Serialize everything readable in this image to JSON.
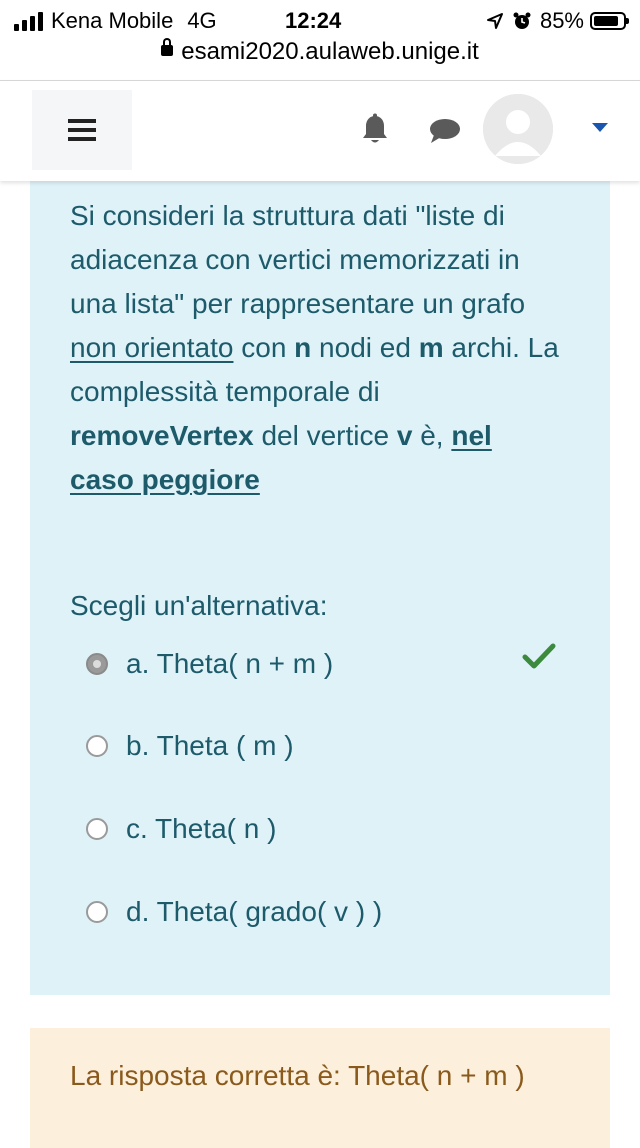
{
  "status_bar": {
    "carrier": "Kena Mobile",
    "network": "4G",
    "time": "12:24",
    "battery_percent": "85%",
    "battery_level": 0.85
  },
  "browser": {
    "url": "esami2020.aulaweb.unige.it"
  },
  "navbar": {
    "menu_icon": "hamburger-icon",
    "notifications_icon": "bell-icon",
    "messages_icon": "chat-bubble-icon",
    "user_icon": "avatar-icon",
    "dropdown_icon": "caret-down-icon",
    "accent_color": "#1a56b0"
  },
  "question": {
    "text_parts": {
      "p1": "Si consideri la struttura dati \"liste di adiacenza con vertici memorizzati in una lista\" per rappresentare un grafo ",
      "p2_underlined": "non orientato",
      "p3": " con ",
      "p4_bold": "n",
      "p5": " nodi ed ",
      "p6_bold": "m",
      "p7": " archi. La complessità temporale di ",
      "p8_bold": "removeVertex",
      "p9": " del vertice ",
      "p10_bold": "v",
      "p11": " è, ",
      "p12_bold_underlined": "nel caso peggiore"
    },
    "prompt": "Scegli un'alternativa:",
    "options": [
      {
        "label": "a. Theta( n + m )",
        "selected": true,
        "correct": true
      },
      {
        "label": "b. Theta ( m )",
        "selected": false
      },
      {
        "label": "c. Theta( n )",
        "selected": false
      },
      {
        "label": "d. Theta( grado( v ) )",
        "selected": false
      }
    ],
    "correct_icon": "checkmark-icon",
    "background_color": "#def2f8",
    "text_color": "#1d5a6a"
  },
  "feedback": {
    "text": "La risposta corretta è: Theta( n + m )",
    "background_color": "#fcefdc",
    "text_color": "#8a5a1c"
  }
}
